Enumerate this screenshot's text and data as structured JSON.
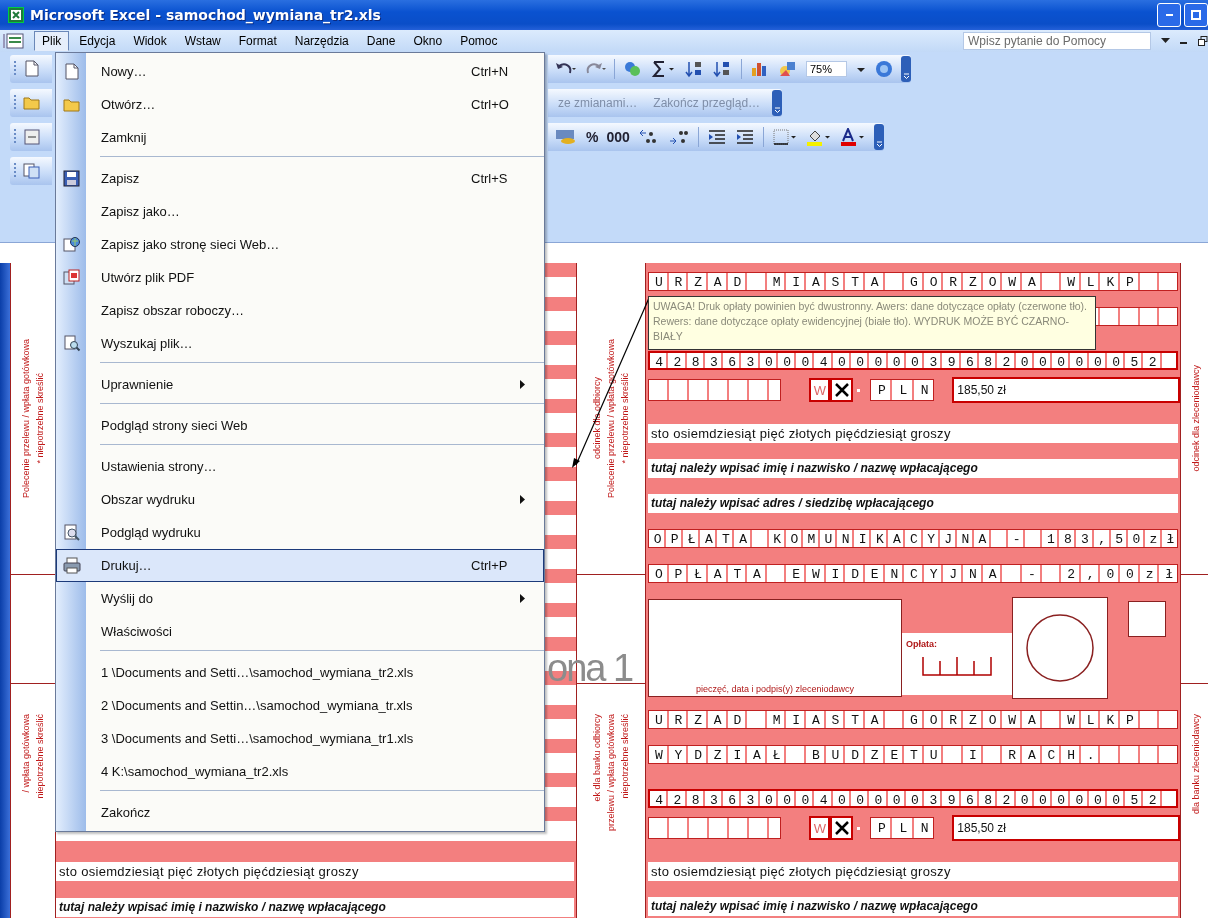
{
  "window": {
    "title": "Microsoft Excel - samochod_wymiana_tr2.xls"
  },
  "menu_bar": {
    "items": [
      {
        "label": "Plik",
        "selected": true
      },
      {
        "label": "Edycja",
        "selected": false
      },
      {
        "label": "Widok",
        "selected": false
      },
      {
        "label": "Wstaw",
        "selected": false
      },
      {
        "label": "Format",
        "selected": false
      },
      {
        "label": "Narzędzia",
        "selected": false
      },
      {
        "label": "Dane",
        "selected": false
      },
      {
        "label": "Okno",
        "selected": false
      },
      {
        "label": "Pomoc",
        "selected": false
      }
    ],
    "help_box": {
      "placeholder": "Wpisz pytanie do Pomocy"
    }
  },
  "toolbars": {
    "zoom": "75%",
    "review": [
      "ze zmianami…",
      "Zakończ przegląd…"
    ],
    "number_buttons": [
      "%",
      "000"
    ]
  },
  "file_menu": {
    "items": [
      {
        "kind": "item",
        "label": "Nowy…",
        "shortcut": "Ctrl+N",
        "selected": false
      },
      {
        "kind": "item",
        "label": "Otwórz…",
        "shortcut": "Ctrl+O",
        "selected": false
      },
      {
        "kind": "item",
        "label": "Zamknij",
        "selected": false
      },
      {
        "kind": "separator"
      },
      {
        "kind": "item",
        "label": "Zapisz",
        "shortcut": "Ctrl+S",
        "selected": false
      },
      {
        "kind": "item",
        "label": "Zapisz jako…",
        "selected": false
      },
      {
        "kind": "item",
        "label": "Zapisz jako stronę sieci Web…",
        "selected": false
      },
      {
        "kind": "item",
        "label": "Utwórz plik PDF",
        "selected": false
      },
      {
        "kind": "item",
        "label": "Zapisz obszar roboczy…",
        "selected": false
      },
      {
        "kind": "item",
        "label": "Wyszukaj plik…",
        "selected": false
      },
      {
        "kind": "separator"
      },
      {
        "kind": "item",
        "label": "Uprawnienie",
        "submenu": true,
        "selected": false
      },
      {
        "kind": "separator"
      },
      {
        "kind": "item",
        "label": "Podgląd strony sieci Web",
        "selected": false
      },
      {
        "kind": "separator"
      },
      {
        "kind": "item",
        "label": "Ustawienia strony…",
        "selected": false
      },
      {
        "kind": "item",
        "label": "Obszar wydruku",
        "submenu": true,
        "selected": false
      },
      {
        "kind": "item",
        "label": "Podgląd wydruku",
        "selected": false
      },
      {
        "kind": "item",
        "label": "Drukuj…",
        "shortcut": "Ctrl+P",
        "selected": true
      },
      {
        "kind": "item",
        "label": "Wyślij do",
        "submenu": true,
        "selected": false
      },
      {
        "kind": "item",
        "label": "Właściwości",
        "selected": false
      },
      {
        "kind": "separator"
      },
      {
        "kind": "item",
        "label": "1 \\Documents and Setti…\\samochod_wymiana_tr2.xls",
        "selected": false
      },
      {
        "kind": "item",
        "label": "2 \\Documents and Settin…\\samochod_wymiana_tr.xls",
        "selected": false
      },
      {
        "kind": "item",
        "label": "3 \\Documents and Setti…\\samochod_wymiana_tr1.xls",
        "selected": false
      },
      {
        "kind": "item",
        "label": "4 K:\\samochod_wymiana_tr2.xls",
        "selected": false
      },
      {
        "kind": "separator"
      },
      {
        "kind": "item",
        "label": "Zakończ",
        "selected": false
      }
    ]
  },
  "sheet": {
    "page_label": "ona 1",
    "comment": "UWAGA! Druk opłaty powinien być dwustronny. Awers: dane dotyczące opłaty (czerwone tło). Rewers: dane dotyczące opłaty ewidencyjnej (białe tło). WYDRUK MOŻE BYĆ CZARNO-BIAŁY",
    "left_strip": {
      "upper": [
        "Polecenie przelewu / wpłata gotówkowa",
        "* niepotrzebne skreślić"
      ],
      "lower": [
        "/ wpłata gotówkowa",
        "niepotrzebne skreślić"
      ]
    },
    "left_form": [
      {
        "kind": "line",
        "text": "sto osiemdziesiąt pięć złotych pięćdziesiąt groszy"
      },
      {
        "kind": "hint",
        "text": "tutaj należy wpisać imię i nazwisko / nazwę wpłacającego"
      }
    ],
    "middle_strip": {
      "upper": [
        "odcinek dla odbiorcy",
        "Polecenie przelewu / wpłata gotówkowa",
        "* niepotrzebne skreślić"
      ],
      "lower": [
        "ek dla banku odbiorcy",
        "przelewu / wpłata gotówkowa",
        "niepotrzebne skreślić"
      ]
    },
    "form_upper": [
      {
        "kind": "cells",
        "text": "URZAD MIASTA GORZOWA WLKP"
      },
      {
        "kind": "blank"
      },
      {
        "kind": "account",
        "text": "4283630004000003968200000052"
      },
      {
        "kind": "amount",
        "flag": "W",
        "checked": true,
        "currency": "PLN",
        "amount": "185,50 zł"
      },
      {
        "kind": "line",
        "text": "sto osiemdziesiąt pięć złotych pięćdziesiąt groszy"
      },
      {
        "kind": "hint",
        "text": "tutaj należy wpisać imię i nazwisko / nazwę wpłacającego"
      },
      {
        "kind": "hint",
        "text": "tutaj należy wpisać adres / siedzibę wpłacającego"
      },
      {
        "kind": "cells",
        "text": "OPŁATA KOMUNIKACYJNA - 183,50zł"
      },
      {
        "kind": "cells",
        "text": "OPŁATA EWIDENCYJNA - 2,00zł"
      }
    ],
    "stamp": {
      "caption": "pieczęć, data i podpis(y) zleceniodawcy",
      "fee_label": "Opłata:"
    },
    "form_lower": [
      {
        "kind": "cells",
        "text": "URZAD MIASTA GORZOWA WLKP"
      },
      {
        "kind": "cells",
        "text": "WYDZIAŁ BUDZETU I RACH."
      },
      {
        "kind": "account",
        "text": "4283630004000003968200000052"
      },
      {
        "kind": "amount",
        "flag": "W",
        "checked": true,
        "currency": "PLN",
        "amount": "185,50 zł"
      },
      {
        "kind": "line",
        "text": "sto osiemdziesiąt pięć złotych pięćdziesiąt groszy"
      },
      {
        "kind": "hint",
        "text": "tutaj należy wpisać imię i nazwisko / nazwę wpłacającego"
      }
    ],
    "right_strip": {
      "upper": [
        "odcinek dla zleceniodawcy"
      ],
      "lower": [
        "dla banku zleceniodawcy"
      ]
    }
  }
}
